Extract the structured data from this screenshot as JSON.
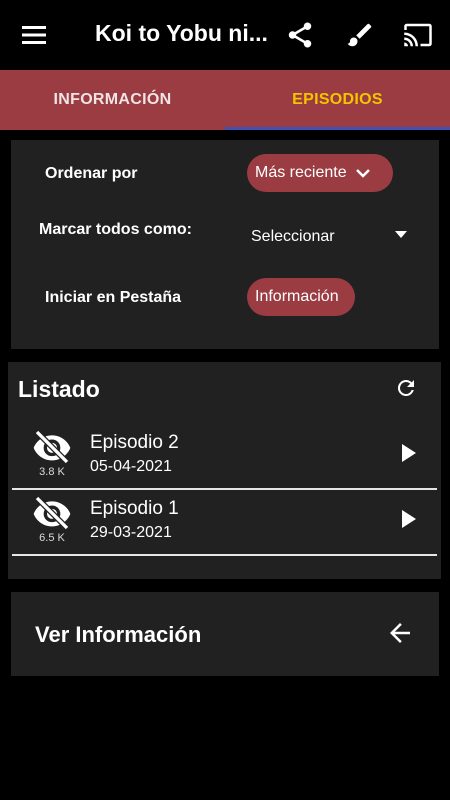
{
  "appbar": {
    "title": "Koi to Yobu ni...",
    "menu_icon": "menu-icon",
    "share_icon": "share-icon",
    "brush_icon": "brush-icon",
    "cast_icon": "cast-icon"
  },
  "tabs": [
    {
      "label": "INFORMACIÓN",
      "selected": false
    },
    {
      "label": "EPISODIOS",
      "selected": true
    }
  ],
  "settings": {
    "order_label": "Ordenar por",
    "order_value": "Más reciente",
    "mark_label": "Marcar todos como:",
    "mark_value": "Seleccionar",
    "start_label": "Iniciar en Pestaña",
    "start_value": "Información"
  },
  "listado": {
    "title": "Listado",
    "refresh_icon": "refresh-icon",
    "episodes": [
      {
        "name": "Episodio 2",
        "date": "05-04-2021",
        "views": "3.8 K"
      },
      {
        "name": "Episodio 1",
        "date": "29-03-2021",
        "views": "6.5 K"
      }
    ]
  },
  "ver_info": {
    "label": "Ver Información",
    "icon": "arrow-back-icon"
  },
  "colors": {
    "accent": "#9a3c42",
    "selected_tab_text": "#f5c400",
    "tab_indicator": "#3f51b5",
    "card_bg": "#212121",
    "background": "#000000"
  }
}
